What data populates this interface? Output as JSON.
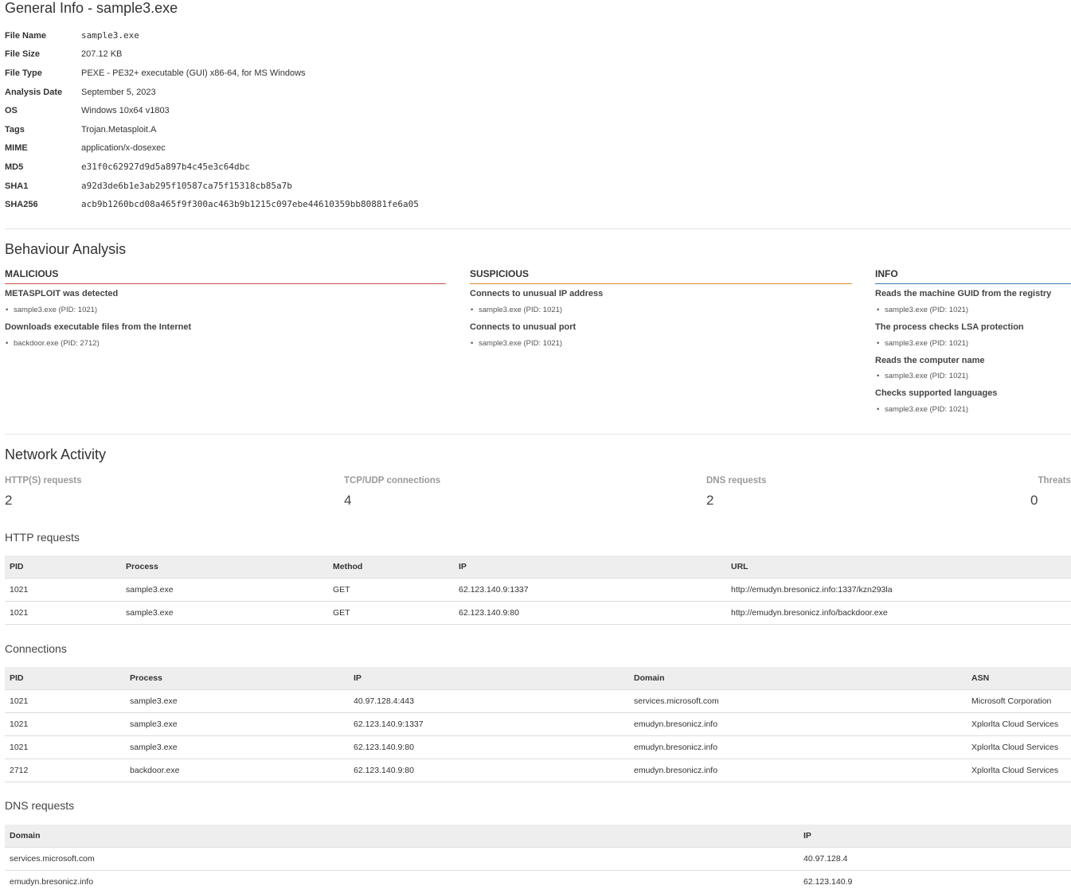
{
  "general": {
    "title": "General Info - sample3.exe",
    "rows": [
      {
        "key": "File Name",
        "value": "sample3.exe",
        "mono": true
      },
      {
        "key": "File Size",
        "value": "207.12 KB",
        "mono": false
      },
      {
        "key": "File Type",
        "value": "PEXE - PE32+ executable (GUI) x86-64, for MS Windows",
        "mono": false
      },
      {
        "key": "Analysis Date",
        "value": "September 5, 2023",
        "mono": false
      },
      {
        "key": "OS",
        "value": "Windows 10x64 v1803",
        "mono": false
      },
      {
        "key": "Tags",
        "value": "Trojan.Metasploit.A",
        "mono": false
      },
      {
        "key": "MIME",
        "value": "application/x-dosexec",
        "mono": false
      },
      {
        "key": "MD5",
        "value": "e31f0c62927d9d5a897b4c45e3c64dbc",
        "mono": true
      },
      {
        "key": "SHA1",
        "value": "a92d3de6b1e3ab295f10587ca75f15318cb85a7b",
        "mono": true
      },
      {
        "key": "SHA256",
        "value": "acb9b1260bcd08a465f9f300ac463b9b1215c097ebe44610359bb80881fe6a05",
        "mono": true
      }
    ]
  },
  "behaviour": {
    "title": "Behaviour Analysis",
    "malicious": {
      "heading": "MALICIOUS",
      "indicators": [
        {
          "title": "METASPLOIT was detected",
          "item": "sample3.exe (PID: 1021)"
        },
        {
          "title": "Downloads executable files from the Internet",
          "item": "backdoor.exe (PID: 2712)"
        }
      ]
    },
    "suspicious": {
      "heading": "SUSPICIOUS",
      "indicators": [
        {
          "title": "Connects to unusual IP address",
          "item": "sample3.exe (PID: 1021)"
        },
        {
          "title": "Connects to unusual port",
          "item": "sample3.exe (PID: 1021)"
        }
      ]
    },
    "info": {
      "heading": "INFO",
      "indicators": [
        {
          "title": "Reads the machine GUID from the registry",
          "item": "sample3.exe (PID: 1021)"
        },
        {
          "title": "The process checks LSA protection",
          "item": "sample3.exe (PID: 1021)"
        },
        {
          "title": "Reads the computer name",
          "item": "sample3.exe (PID: 1021)"
        },
        {
          "title": "Checks supported languages",
          "item": "sample3.exe (PID: 1021)"
        }
      ]
    }
  },
  "network": {
    "title": "Network Activity",
    "stats": [
      {
        "label": "HTTP(S) requests",
        "value": "2"
      },
      {
        "label": "TCP/UDP connections",
        "value": "4"
      },
      {
        "label": "DNS requests",
        "value": "2"
      },
      {
        "label": "Threats",
        "value": "0"
      }
    ],
    "http": {
      "title": "HTTP requests",
      "headers": [
        "PID",
        "Process",
        "Method",
        "IP",
        "URL"
      ],
      "rows": [
        [
          "1021",
          "sample3.exe",
          "GET",
          "62.123.140.9:1337",
          "http://emudyn.bresonicz.info:1337/kzn293la"
        ],
        [
          "1021",
          "sample3.exe",
          "GET",
          "62.123.140.9:80",
          "http://emudyn.bresonicz.info/backdoor.exe"
        ]
      ]
    },
    "connections": {
      "title": "Connections",
      "headers": [
        "PID",
        "Process",
        "IP",
        "Domain",
        "ASN"
      ],
      "rows": [
        [
          "1021",
          "sample3.exe",
          "40.97.128.4:443",
          "services.microsoft.com",
          "Microsoft Corporation"
        ],
        [
          "1021",
          "sample3.exe",
          "62.123.140.9:1337",
          "emudyn.bresonicz.info",
          "Xplorlta Cloud Services"
        ],
        [
          "1021",
          "sample3.exe",
          "62.123.140.9:80",
          "emudyn.bresonicz.info",
          "Xplorlta Cloud Services"
        ],
        [
          "2712",
          "backdoor.exe",
          "62.123.140.9:80",
          "emudyn.bresonicz.info",
          "Xplorlta Cloud Services"
        ]
      ]
    },
    "dns": {
      "title": "DNS requests",
      "headers": [
        "Domain",
        "IP"
      ],
      "rows": [
        [
          "services.microsoft.com",
          "40.97.128.4"
        ],
        [
          "emudyn.bresonicz.info",
          "62.123.140.9"
        ]
      ]
    }
  }
}
